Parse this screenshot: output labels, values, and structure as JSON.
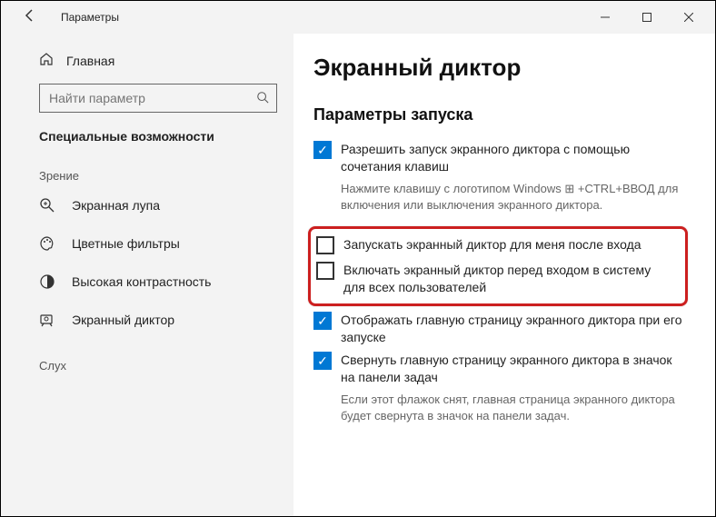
{
  "titlebar": {
    "app_title": "Параметры"
  },
  "sidebar": {
    "home_label": "Главная",
    "search_placeholder": "Найти параметр",
    "section_title": "Специальные возможности",
    "group1_label": "Зрение",
    "items": [
      {
        "label": "Экранная лупа"
      },
      {
        "label": "Цветные фильтры"
      },
      {
        "label": "Высокая контрастность"
      },
      {
        "label": "Экранный диктор"
      }
    ],
    "group2_label": "Слух"
  },
  "main": {
    "page_title": "Экранный диктор",
    "subsection_title": "Параметры запуска",
    "opt_allow_shortcut": "Разрешить запуск экранного диктора с помощью сочетания клавиш",
    "helper_shortcut": "Нажмите клавишу с логотипом Windows ⊞ +CTRL+ВВОД для включения или выключения экранного диктора.",
    "opt_start_after_signin": "Запускать экранный диктор для меня после входа",
    "opt_start_before_signin": "Включать экранный диктор перед входом в систему для всех пользователей",
    "opt_show_home": "Отображать главную страницу экранного диктора при его запуске",
    "opt_minimize_tray": "Свернуть главную страницу экранного диктора в значок на панели задач",
    "helper_tray": "Если этот флажок снят, главная страница экранного диктора будет свернута в значок на панели задач."
  }
}
